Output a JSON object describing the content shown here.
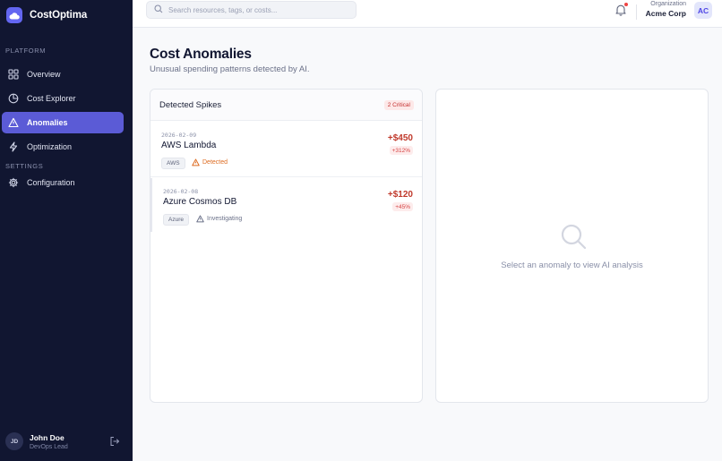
{
  "brand": {
    "name": "CostOptima",
    "accent": "#6366f1"
  },
  "sidebar": {
    "platform_label": "PLATFORM",
    "settings_label": "SETTINGS",
    "items": [
      {
        "label": "Overview",
        "icon": "grid-icon"
      },
      {
        "label": "Cost Explorer",
        "icon": "pie-chart-icon"
      },
      {
        "label": "Anomalies",
        "icon": "alert-triangle-icon",
        "active": true
      },
      {
        "label": "Optimization",
        "icon": "lightning-icon"
      }
    ],
    "settings_items": [
      {
        "label": "Configuration",
        "icon": "gear-icon"
      }
    ],
    "user": {
      "initials": "JD",
      "name": "John Doe",
      "role": "DevOps Lead"
    }
  },
  "topbar": {
    "search_placeholder": "Search resources, tags, or costs...",
    "org_label": "Organization",
    "org_name": "Acme Corp",
    "org_initials": "AC"
  },
  "main": {
    "title": "Cost Anomalies",
    "subtitle": "Unusual spending patterns detected by AI.",
    "list": {
      "title": "Detected Spikes",
      "badge": "2 Critical",
      "rows": [
        {
          "date": "2026-02-09",
          "name": "AWS Lambda",
          "provider": "AWS",
          "status": "Detected",
          "status_color": "#dd6b20",
          "amount": "+$450",
          "percent": "+312%"
        },
        {
          "date": "2026-02-08",
          "name": "Azure Cosmos DB",
          "provider": "Azure",
          "status": "Investigating",
          "status_color": "#6b7189",
          "amount": "+$120",
          "percent": "+45%"
        }
      ]
    },
    "detail": {
      "empty_text": "Select an anomaly to view AI analysis"
    }
  }
}
